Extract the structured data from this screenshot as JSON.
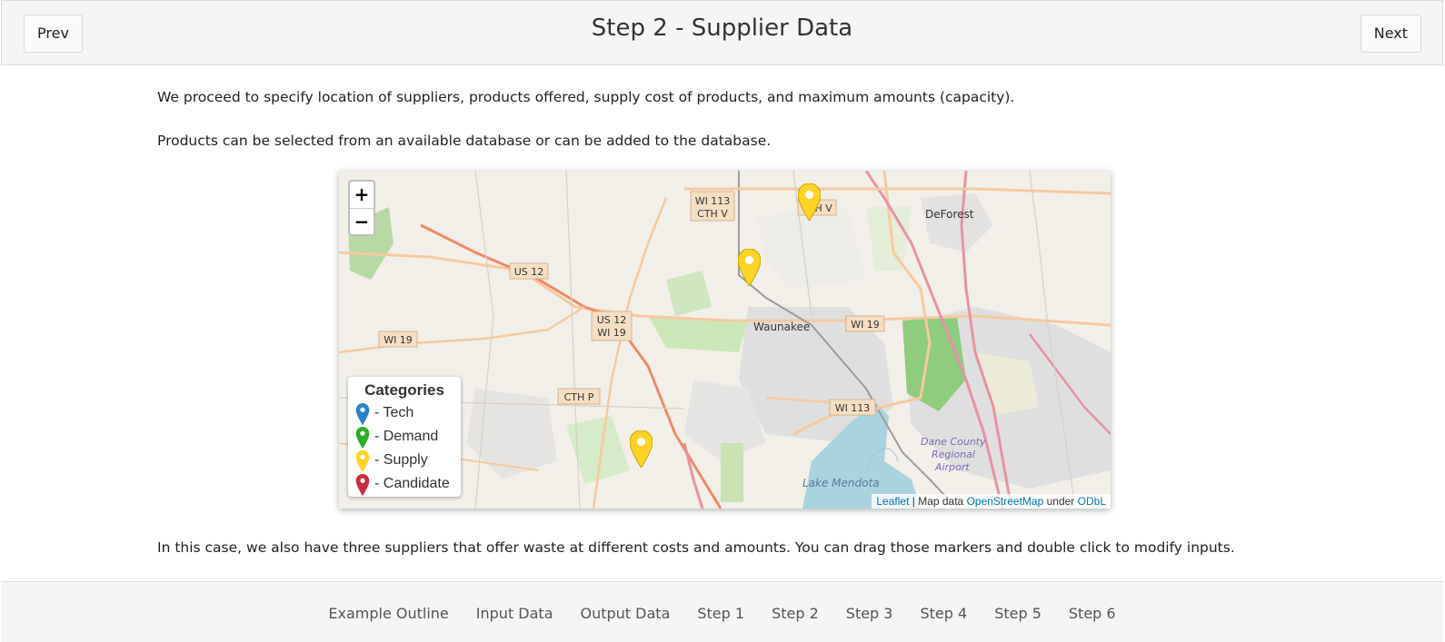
{
  "header": {
    "title": "Step 2 - Supplier Data",
    "prev_label": "Prev",
    "next_label": "Next"
  },
  "content": {
    "p1": "We proceed to specify location of suppliers, products offered, supply cost of products, and maximum amounts (capacity).",
    "p2": "Products can be selected from an available database or can be added to the database.",
    "p3": "In this case, we also have three suppliers that offer waste at different costs and amounts. You can drag those markers and double click to modify inputs."
  },
  "map": {
    "zoom_in": "+",
    "zoom_out": "−",
    "place_labels": [
      "DeForest",
      "Waunakee",
      "Lake Mendota",
      "Dane County",
      "Regional",
      "Airport"
    ],
    "road_labels": [
      "WI 113",
      "CTH V",
      "US 12",
      "WI 19",
      "CTH P",
      "US 12",
      "WI 19",
      "WI 19",
      "WI 113",
      "CTH V"
    ],
    "legend": {
      "title": "Categories",
      "items": [
        {
          "label": "- Tech",
          "color": "#2a81cb"
        },
        {
          "label": "- Demand",
          "color": "#2aad27"
        },
        {
          "label": "- Supply",
          "color": "#ffd326"
        },
        {
          "label": "- Candidate",
          "color": "#cb2b3e"
        }
      ]
    },
    "attribution": {
      "leaflet": "Leaflet",
      "sep": " | Map data ",
      "osm": "OpenStreetMap",
      "under": " under ",
      "odbl": "ODbL"
    },
    "markers": [
      {
        "category": "Supply"
      },
      {
        "category": "Supply"
      },
      {
        "category": "Supply"
      }
    ]
  },
  "footer": {
    "links": [
      "Example Outline",
      "Input Data",
      "Output Data",
      "Step 1",
      "Step 2",
      "Step 3",
      "Step 4",
      "Step 5",
      "Step 6"
    ]
  }
}
